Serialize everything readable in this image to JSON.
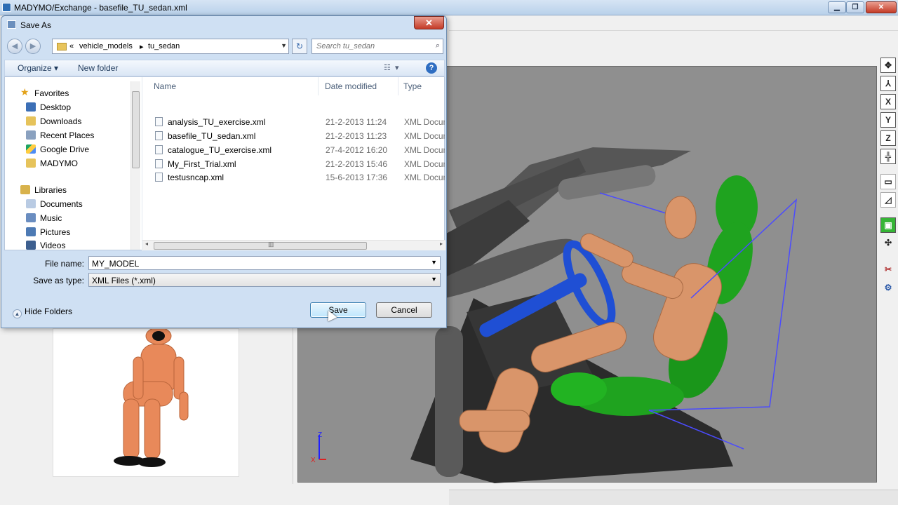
{
  "window": {
    "title": "MADYMO/Exchange - basefile_TU_sedan.xml",
    "controls": {
      "minimize": "▁",
      "maximize": "❐",
      "close": "✕"
    }
  },
  "dialog": {
    "title": "Save As",
    "close_label": "✕",
    "breadcrumb": {
      "prefix": "«",
      "parts": [
        "vehicle_models",
        "tu_sedan"
      ]
    },
    "search_placeholder": "Search tu_sedan",
    "commands": {
      "organize": "Organize ▾",
      "new_folder": "New folder",
      "help": "?"
    },
    "nav": {
      "favorites_header": "Favorites",
      "favorites": [
        "Desktop",
        "Downloads",
        "Recent Places",
        "Google Drive",
        "MADYMO"
      ],
      "libraries_header": "Libraries",
      "libraries": [
        "Documents",
        "Music",
        "Pictures",
        "Videos"
      ]
    },
    "columns": {
      "name": "Name",
      "date": "Date modified",
      "type": "Type"
    },
    "files": [
      {
        "name": "analysis_TU_exercise.xml",
        "date": "21-2-2013 11:24",
        "type": "XML Docum"
      },
      {
        "name": "basefile_TU_sedan.xml",
        "date": "21-2-2013 11:23",
        "type": "XML Docum"
      },
      {
        "name": "catalogue_TU_exercise.xml",
        "date": "27-4-2012 16:20",
        "type": "XML Docum"
      },
      {
        "name": "My_First_Trial.xml",
        "date": "21-2-2013 15:46",
        "type": "XML Docum"
      },
      {
        "name": "testusncap.xml",
        "date": "15-6-2013 17:36",
        "type": "XML Docum"
      }
    ],
    "filename_label": "File name:",
    "filename_value": "MY_MODEL",
    "savetype_label": "Save as type:",
    "savetype_value": "XML Files (*.xml)",
    "hide_folders": "Hide Folders",
    "save_button": "Save",
    "cancel_button": "Cancel"
  },
  "viewport": {
    "axis_labels": {
      "z": "Z",
      "x": "X"
    }
  },
  "colors": {
    "viewport_bg": "#8f8f8f",
    "dummy": "#d9956a",
    "seat": "#22a322",
    "wheel": "#1f4fd4",
    "car": "#505050"
  }
}
